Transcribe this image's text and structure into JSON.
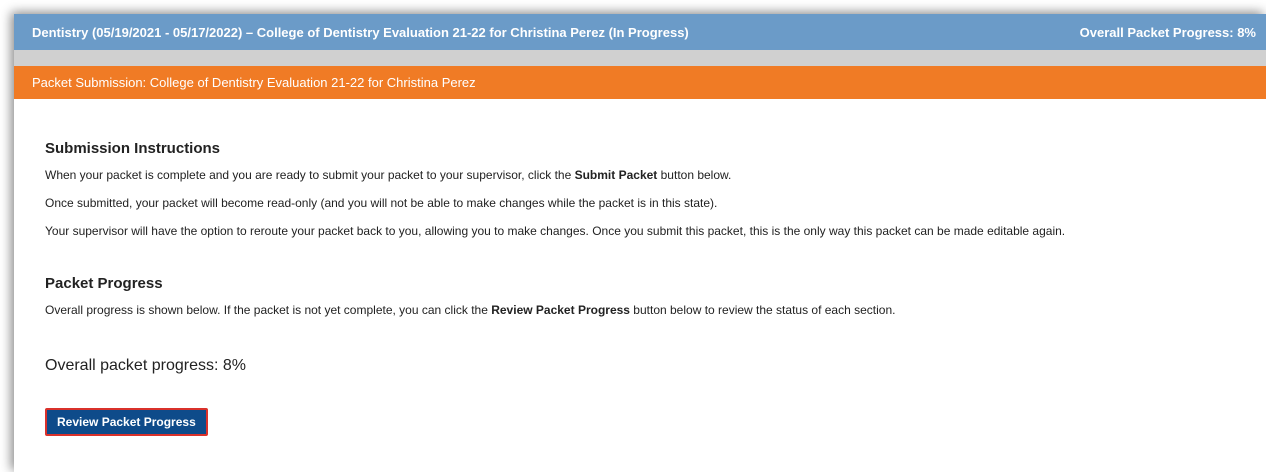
{
  "header": {
    "title": "Dentistry (05/19/2021 - 05/17/2022) – College of Dentistry Evaluation 21-22 for Christina Perez (In Progress)",
    "overall_progress": "Overall Packet Progress: 8%"
  },
  "submission_bar": {
    "title": "Packet Submission: College of Dentistry Evaluation 21-22 for Christina Perez"
  },
  "instructions": {
    "heading": "Submission Instructions",
    "line1_before": "When your packet is complete and you are ready to submit your packet to your supervisor, click the ",
    "line1_bold": "Submit Packet",
    "line1_after": " button below.",
    "line2": "Once submitted, your packet will become read-only (and you will not be able to make changes while the packet is in this state).",
    "line3": "Your supervisor will have the option to reroute your packet back to you, allowing you to make changes. Once you submit this packet, this is the only way this packet can be made editable again."
  },
  "progress": {
    "heading": "Packet Progress",
    "desc_before": "Overall progress is shown below. If the packet is not yet complete, you can click the ",
    "desc_bold": "Review Packet Progress",
    "desc_after": " button below to review the status of each section.",
    "overall_text": "Overall packet progress: 8%",
    "button_label": "Review Packet Progress"
  },
  "colors": {
    "header_bg": "#6b9bc8",
    "submission_bar_bg": "#f07b25",
    "button_bg": "#0e4b8a",
    "button_border": "#d9312b"
  }
}
